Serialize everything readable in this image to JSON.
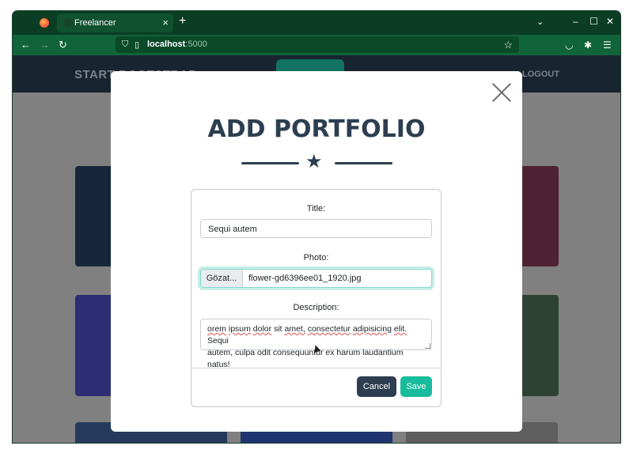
{
  "browser": {
    "tab_title": "Freelancer",
    "tab_close": "×",
    "new_tab": "+",
    "tab_list": "⌄",
    "window_min": "–",
    "window_max": "☐",
    "window_close": "✕",
    "url_host": "localhost",
    "url_port": ":5000",
    "nav_back": "←",
    "nav_forward": "→",
    "nav_reload": "↻",
    "bookmark": "☆"
  },
  "site": {
    "brand": "START BOOTSTRAP",
    "logout": "LOGOUT",
    "tile_colors": [
      "#1f3a55",
      "#5a2a3a",
      "#3b3c8a",
      "#354c3a",
      "#2a3f6a",
      "#25407a",
      "#6e6e6e"
    ]
  },
  "modal": {
    "title": "ADD PORTFOLIO",
    "close_icon": "close-icon",
    "form": {
      "title_label": "Title:",
      "title_value": "Sequi autem",
      "photo_label": "Photo:",
      "photo_button": "Gözat...",
      "photo_filename": "flower-gd6396ee01_1920.jpg",
      "description_label": "Description:",
      "description_line1_words": [
        "orem",
        "ipsum",
        "dolor",
        "sit",
        "amet,",
        "consectetur",
        "adipisicing",
        "elit.",
        "Sequi"
      ],
      "description_line2": "autem, culpa odit consequuntur ex harum laudantium natus!",
      "cancel_label": "Cancel",
      "save_label": "Save"
    }
  },
  "colors": {
    "primary_dark": "#2c3e50",
    "accent": "#18bc9c",
    "browser_chrome": "#11633a"
  }
}
